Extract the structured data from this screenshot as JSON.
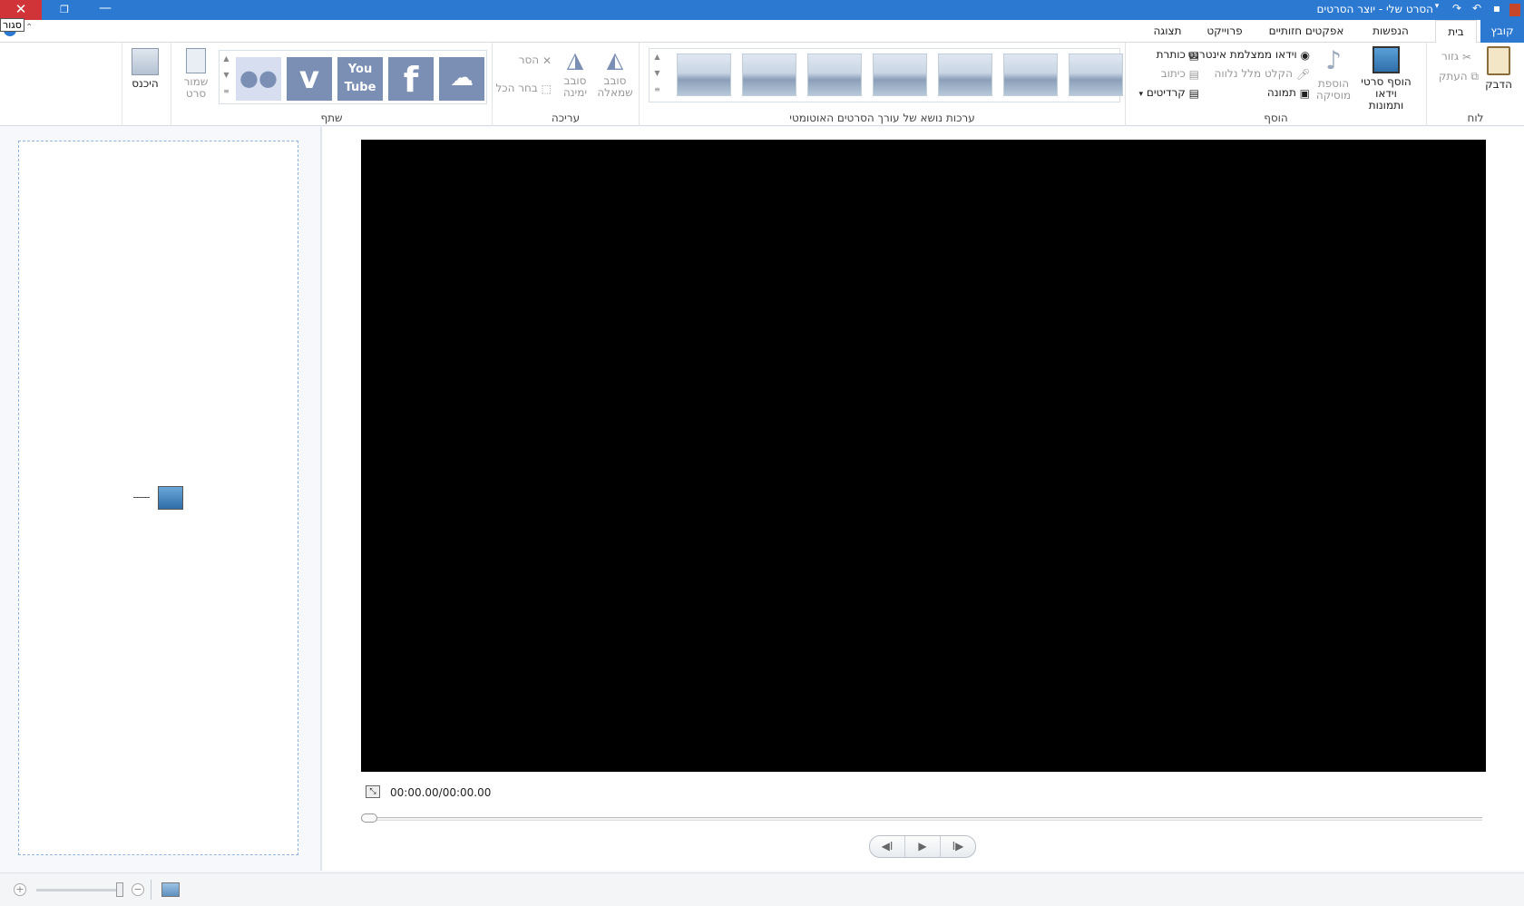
{
  "window": {
    "title": "הסרט שלי - יוצר הסרטים",
    "close_glyph": "✕",
    "restore_glyph": "❐",
    "minimize_glyph": "—",
    "tooltip": "סגור",
    "accent": "#2b79d0"
  },
  "tabs": {
    "file": "קובץ",
    "home": "בית",
    "animations": "הנפשות",
    "visual_effects": "אפקטים חזותיים",
    "project": "פרוייקט",
    "view": "תצוגה"
  },
  "ribbon": {
    "clipboard": {
      "label": "לוח",
      "paste": "הדבק",
      "cut": "גזור",
      "copy": "העתק"
    },
    "add": {
      "label": "הוסף",
      "add_videos_photos": "הוסף סרטי וידאו ותמונות",
      "add_music": "הוספת מוסיקה",
      "webcam_video": "וידאו ממצלמת אינטרנט",
      "record_narration": "הקלט מלל נלווה",
      "snapshot": "תמונה",
      "title": "כותרת",
      "caption": "כיתוב",
      "credits": "קרדיטים"
    },
    "themes": {
      "label": "ערכות נושא של עורך הסרטים האוטומטי",
      "count": 7
    },
    "editing": {
      "label": "עריכה",
      "rotate_left": "סובב שמאלה",
      "rotate_right": "סובב ימינה",
      "remove": "הסר",
      "select_all": "בחר הכל"
    },
    "share": {
      "label": "שתף",
      "services": [
        "onedrive",
        "facebook",
        "youtube",
        "vimeo",
        "flickr"
      ],
      "youtube_text": "You Tube",
      "save_movie": "שמור סרט"
    },
    "signin": {
      "label": "היכנס"
    }
  },
  "player": {
    "timecode": "00:00.00/00:00.00",
    "prev_frame": "◀I",
    "play": "▶",
    "next_frame": "I▶"
  },
  "statusbar": {
    "zoom_plus": "+",
    "zoom_minus": "−"
  }
}
